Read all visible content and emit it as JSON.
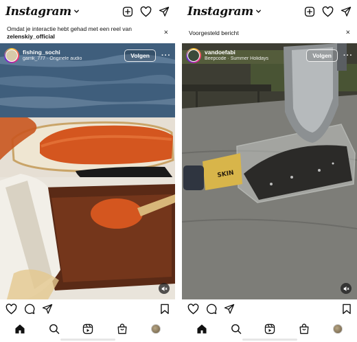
{
  "colors": {
    "text": "#111111",
    "follow_border": "#ffffff",
    "mute_bg": "#1e1e1e"
  },
  "phones": [
    {
      "app": {
        "logo": "Instagram"
      },
      "banner": {
        "line1": "Omdat je interactie hebt gehad met een reel van",
        "bold": "zelenskiy_official",
        "close": "×"
      },
      "post": {
        "username": "fishing_sochi",
        "subtitle": "garrik_777 · Originele audio",
        "follow_label": "Volgen",
        "more": "···"
      }
    },
    {
      "app": {
        "logo": "Instagram"
      },
      "banner": {
        "line1": "Voorgesteld bericht",
        "close": "×"
      },
      "post": {
        "username": "vandoefabi",
        "subtitle": "Beepcode · Summer Holidays",
        "follow_label": "Volgen",
        "more": "···"
      }
    }
  ],
  "icons": {
    "top": [
      "create-icon",
      "heart-icon",
      "send-icon"
    ],
    "actions": [
      "heart-icon",
      "comment-icon",
      "share-icon",
      "save-icon"
    ],
    "nav": [
      "home-icon",
      "search-icon",
      "reels-icon",
      "shop-icon",
      "profile-avatar"
    ]
  }
}
